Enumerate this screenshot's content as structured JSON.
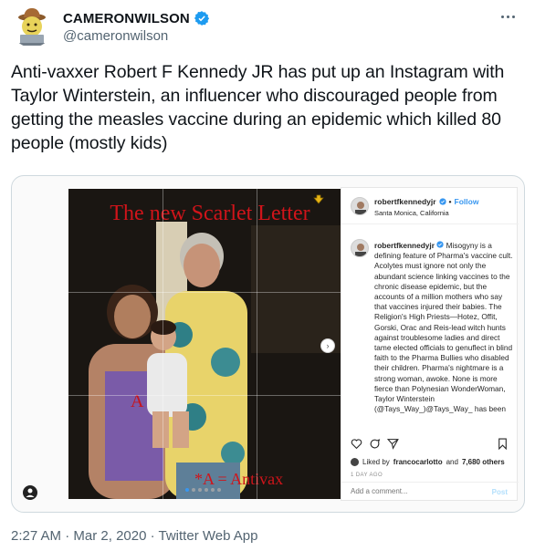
{
  "tweet": {
    "display_name": "CAMERONWILSON",
    "handle": "@cameronwilson",
    "text": "Anti-vaxxer Robert F Kennedy JR has put up an Instagram with Taylor Winterstein, an influencer who discouraged people from getting the measles vaccine during an epidemic which killed 80 people (mostly kids)",
    "time": "2:27 AM",
    "separator": "·",
    "date": "Mar 2, 2020",
    "source": "Twitter Web App"
  },
  "instagram": {
    "post_title": "The new Scarlet Letter",
    "post_letter": "A",
    "post_caption": "*A = Antivax",
    "username": "robertfkennedyjr",
    "follow_sep": "•",
    "follow_label": "Follow",
    "location": "Santa Monica, California",
    "caption": "Misogyny is a defining feature of Pharma's vaccine cult. Acolytes must ignore not only the abundant science linking vaccines to the chronic disease epidemic, but the accounts of a million mothers who say that vaccines injured their babies. The Religion's High Priests—Hotez, Offit, Gorski, Orac and Reis-lead witch hunts against troublesome ladies and direct tame elected officials to genuflect in blind faith to the Pharma Bullies who disabled their children. Pharma's nightmare is a strong woman, awoke. None is more fierce than Polynesian WonderWoman, Taylor Winterstein (@Tays_Way_)@Tays_Way_ has been",
    "likes_prefix": "Liked by",
    "liked_by": "francocarlotto",
    "likes_and": "and",
    "likes_count": "7,680 others",
    "post_date": "1 DAY AGO",
    "comment_placeholder": "Add a comment...",
    "post_button": "Post"
  },
  "colors": {
    "twitter_blue": "#1d9bf0",
    "instagram_blue": "#3897f0",
    "scarlet": "#d0141a"
  },
  "icons": [
    "verified-badge-icon",
    "more-options-icon",
    "heart-icon",
    "comment-icon",
    "share-icon",
    "bookmark-icon",
    "next-arrow-icon",
    "user-icon"
  ]
}
